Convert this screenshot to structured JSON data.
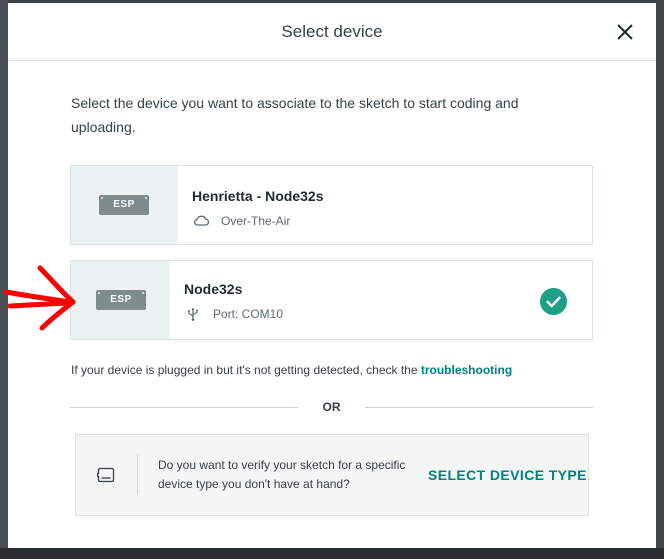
{
  "modal": {
    "title": "Select device",
    "intro": "Select the device you want to associate to the sketch to start coding and uploading."
  },
  "devices": [
    {
      "name": "Henrietta - Node32s",
      "chip_label": "ESP",
      "connection": "Over-The-Air",
      "connection_icon": "cloud-icon",
      "selected": false
    },
    {
      "name": "Node32s",
      "chip_label": "ESP",
      "connection": "Port: COM10",
      "connection_icon": "usb-icon",
      "selected": true
    }
  ],
  "hint": {
    "text": "If your device is plugged in but it's not getting detected, check the ",
    "link": "troubleshooting"
  },
  "divider": {
    "text": "OR"
  },
  "verify": {
    "text": "Do you want to verify your sketch for a specific device type you don't have at hand?",
    "link": "SELECT DEVICE TYPE"
  },
  "colors": {
    "accent": "#008184",
    "check": "#1da086",
    "chip": "#7f8c8d",
    "annotation_arrow": "#ff0000"
  }
}
